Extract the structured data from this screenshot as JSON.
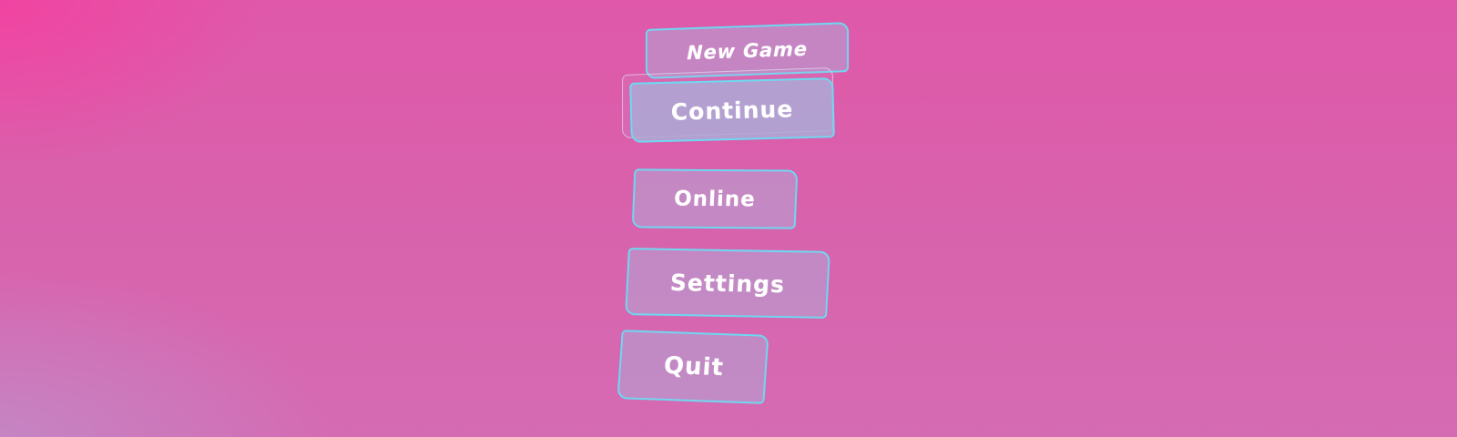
{
  "menu": {
    "new_game": "New Game",
    "continue": "Continue",
    "online": "Online",
    "settings": "Settings",
    "quit": "Quit"
  },
  "colors": {
    "background_primary": "#df58a9",
    "background_corner_top_left": "#f440a0",
    "background_corner_bottom_left": "#c486c4",
    "button_border": "#6fd8f0",
    "button_fill": "#b6a0d2",
    "button_text": "#ffffff"
  }
}
